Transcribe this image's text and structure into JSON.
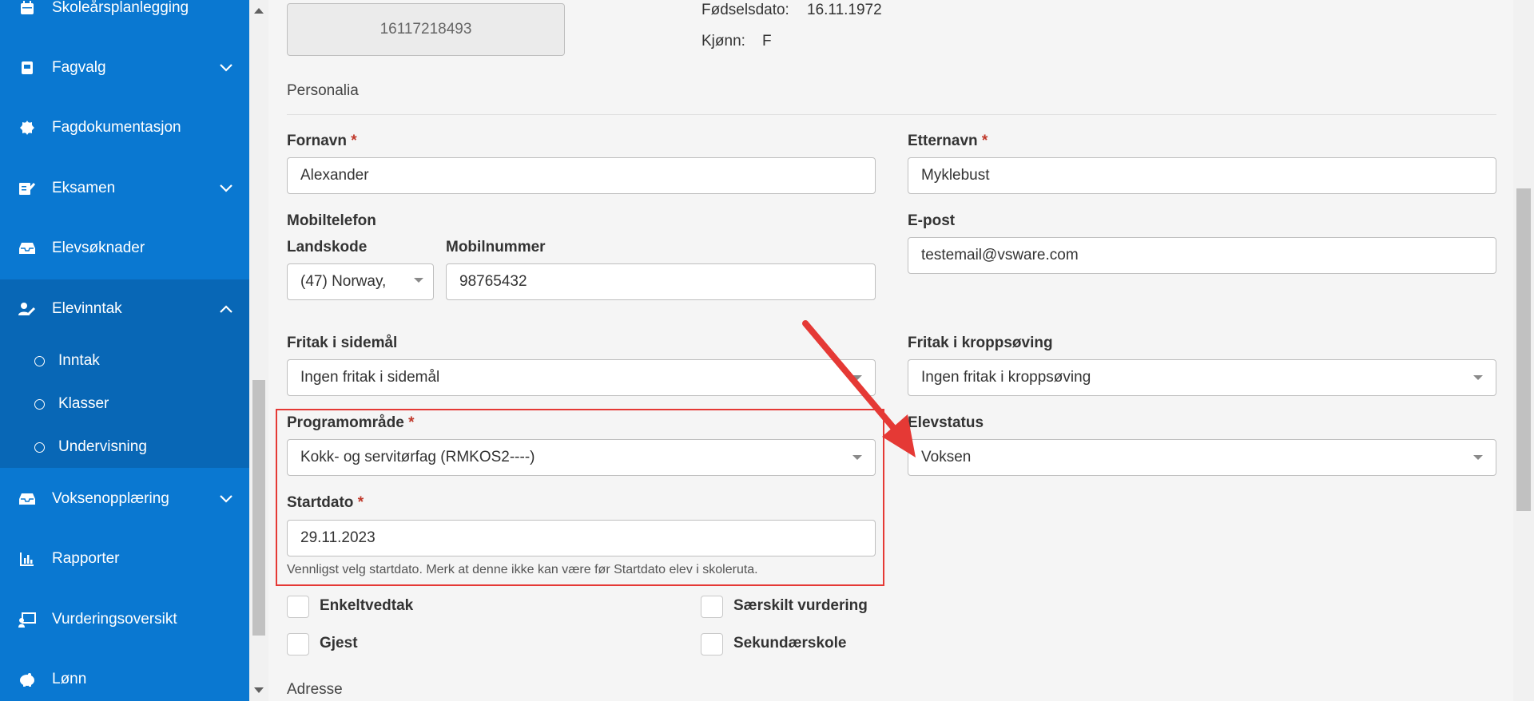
{
  "sidebar": {
    "items": [
      {
        "label": "Skoleårsplanlegging",
        "icon": "calendar-icon"
      },
      {
        "label": "Fagvalg",
        "icon": "book-icon"
      },
      {
        "label": "Fagdokumentasjon",
        "icon": "badge-icon"
      },
      {
        "label": "Eksamen",
        "icon": "exam-icon"
      },
      {
        "label": "Elevsøknader",
        "icon": "inbox-icon"
      },
      {
        "label": "Elevinntak",
        "icon": "user-edit-icon"
      },
      {
        "label": "Voksenopplæring",
        "icon": "inbox-icon"
      },
      {
        "label": "Rapporter",
        "icon": "bar-chart-icon"
      },
      {
        "label": "Vurderingsoversikt",
        "icon": "presentation-icon"
      },
      {
        "label": "Lønn",
        "icon": "piggy-bank-icon"
      }
    ],
    "sub_items": [
      {
        "label": "Inntak"
      },
      {
        "label": "Klasser"
      },
      {
        "label": "Undervisning"
      }
    ]
  },
  "person": {
    "id_number": "16117218493",
    "birthdate_label": "Fødselsdato:",
    "birthdate_value": "16.11.1972",
    "gender_label": "Kjønn:",
    "gender_value": "F"
  },
  "section": {
    "personalia": "Personalia",
    "adresse": "Adresse"
  },
  "form": {
    "fornavn_label": "Fornavn",
    "fornavn_value": "Alexander",
    "etternavn_label": "Etternavn",
    "etternavn_value": "Myklebust",
    "mobiltelefon_label": "Mobiltelefon",
    "landskode_label": "Landskode",
    "landskode_value": "(47) Norway,",
    "mobilnummer_label": "Mobilnummer",
    "mobilnummer_value": "98765432",
    "epost_label": "E-post",
    "epost_value": "testemail@vsware.com",
    "fritak_sidemal_label": "Fritak i sidemål",
    "fritak_sidemal_value": "Ingen fritak i sidemål",
    "fritak_kropp_label": "Fritak i kroppsøving",
    "fritak_kropp_value": "Ingen fritak i kroppsøving",
    "programomrade_label": "Programområde",
    "programomrade_value": "Kokk- og servitørfag (RMKOS2----)",
    "elevstatus_label": "Elevstatus",
    "elevstatus_value": "Voksen",
    "startdato_label": "Startdato",
    "startdato_value": "29.11.2023",
    "startdato_hint": "Vennligst velg startdato. Merk at denne ikke kan være før Startdato elev i skoleruta.",
    "required_mark": "*"
  },
  "checkboxes": {
    "enkeltvedtak": "Enkeltvedtak",
    "gjest": "Gjest",
    "saerskilt": "Særskilt vurdering",
    "sekundaerskole": "Sekundærskole"
  },
  "colors": {
    "sidebar": "#0a78d1",
    "sidebar_active": "#0867b6",
    "required": "#c0392b",
    "annotation": "#e53935"
  }
}
